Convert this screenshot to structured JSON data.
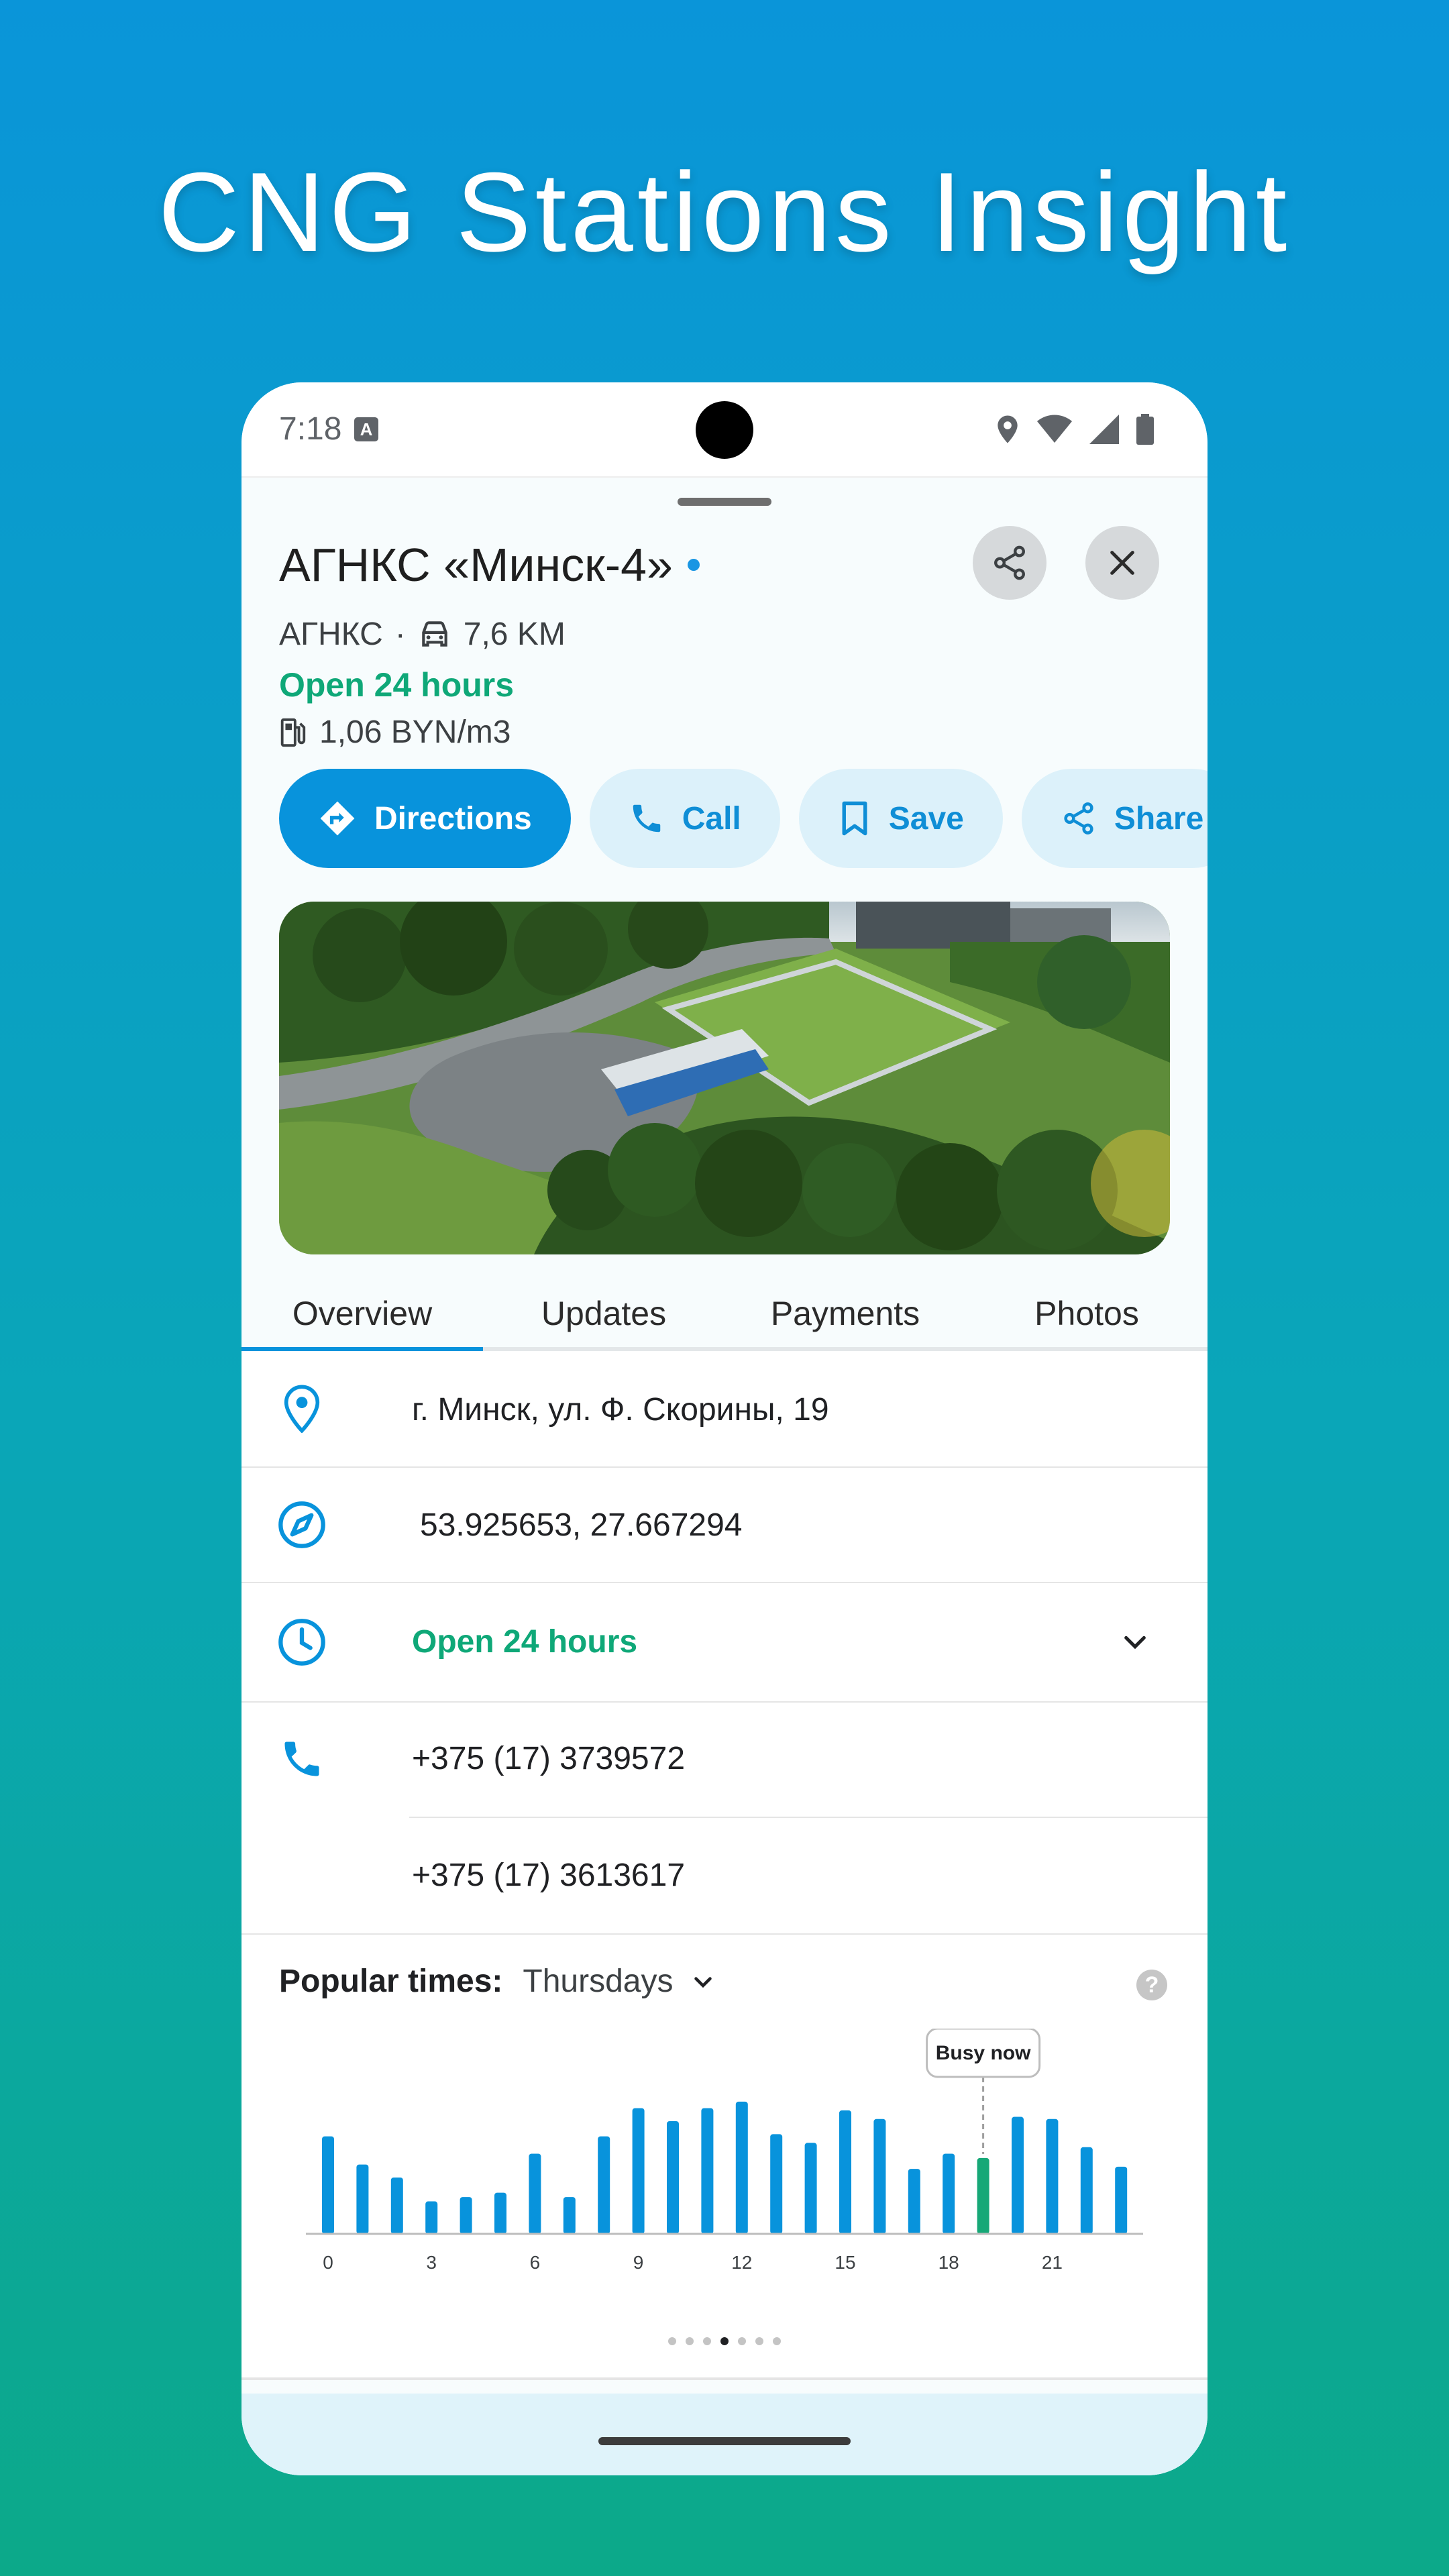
{
  "headline": "CNG Stations Insight",
  "status_bar": {
    "time": "7:18"
  },
  "place": {
    "name": "АГНКС «Минск-4»",
    "category": "АГНКС",
    "separator": "·",
    "distance": "7,6 KM",
    "hours_status": "Open 24 hours",
    "price": "1,06 BYN/m3"
  },
  "actions": [
    {
      "label": "Directions",
      "icon": "directions-icon"
    },
    {
      "label": "Call",
      "icon": "phone-icon"
    },
    {
      "label": "Save",
      "icon": "bookmark-icon"
    },
    {
      "label": "Share",
      "icon": "share-icon"
    }
  ],
  "tabs": [
    "Overview",
    "Updates",
    "Payments",
    "Photos"
  ],
  "active_tab": "Overview",
  "details": {
    "address": "г. Минск, ул. Ф. Скорины, 19",
    "coordinates": "53.925653, 27.667294",
    "hours": "Open 24 hours",
    "phone_1": "+375 (17) 3739572",
    "phone_2": "+375 (17) 3613617"
  },
  "popular_times": {
    "label": "Popular times:",
    "day": "Thursdays",
    "busy_label": "Busy now",
    "help": "?"
  },
  "colors": {
    "accent": "#0893DC",
    "open_green": "#0FA878",
    "busy_bar": "#16A877"
  },
  "chart_data": {
    "type": "bar",
    "x": [
      0,
      1,
      2,
      3,
      4,
      5,
      6,
      7,
      8,
      9,
      10,
      11,
      12,
      13,
      14,
      15,
      16,
      17,
      18,
      19,
      20,
      21,
      22,
      23
    ],
    "x_tick_labels": [
      "0",
      "3",
      "6",
      "9",
      "12",
      "15",
      "18",
      "21"
    ],
    "x_ticks": [
      0,
      3,
      6,
      9,
      12,
      15,
      18,
      21
    ],
    "values": [
      45,
      32,
      26,
      15,
      17,
      19,
      37,
      17,
      45,
      58,
      52,
      58,
      61,
      46,
      42,
      57,
      53,
      30,
      37,
      35,
      54,
      53,
      40,
      31
    ],
    "highlight_index": 19,
    "ylim": [
      0,
      100
    ]
  },
  "pagination": {
    "count": 7,
    "active": 3
  }
}
